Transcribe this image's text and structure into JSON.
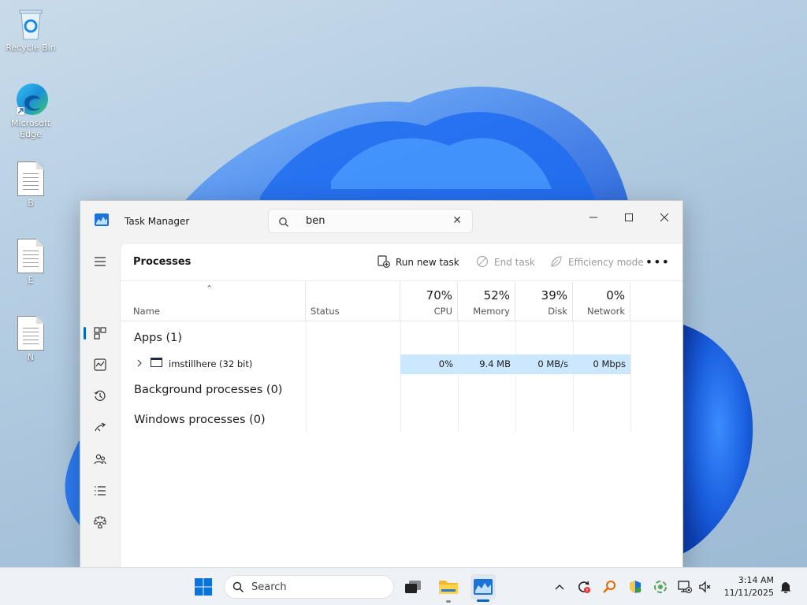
{
  "desktop": {
    "icons": [
      {
        "label": "Recycle Bin"
      },
      {
        "label": "Microsoft Edge"
      },
      {
        "label": "B"
      },
      {
        "label": "E"
      },
      {
        "label": "N"
      }
    ]
  },
  "window": {
    "title": "Task Manager",
    "search": {
      "value": "ben"
    },
    "page_title": "Processes",
    "toolbar": {
      "run_new_task": "Run new task",
      "end_task": "End task",
      "efficiency_mode": "Efficiency mode",
      "more": "•••"
    },
    "columns": {
      "name": "Name",
      "status": "Status",
      "cpu": {
        "pct": "70%",
        "label": "CPU"
      },
      "memory": {
        "pct": "52%",
        "label": "Memory"
      },
      "disk": {
        "pct": "39%",
        "label": "Disk"
      },
      "network": {
        "pct": "0%",
        "label": "Network"
      }
    },
    "groups": {
      "apps": "Apps (1)",
      "background": "Background processes (0)",
      "windows": "Windows processes (0)"
    },
    "process": {
      "name": "imstillhere (32 bit)",
      "cpu": "0%",
      "memory": "9.4 MB",
      "disk": "0 MB/s",
      "network": "0 Mbps"
    }
  },
  "taskbar": {
    "search_label": "Search",
    "time": "3:14 AM",
    "date": "11/11/2025"
  },
  "colors": {
    "accent": "#0067c0",
    "row_highlight": "#cce8ff"
  }
}
